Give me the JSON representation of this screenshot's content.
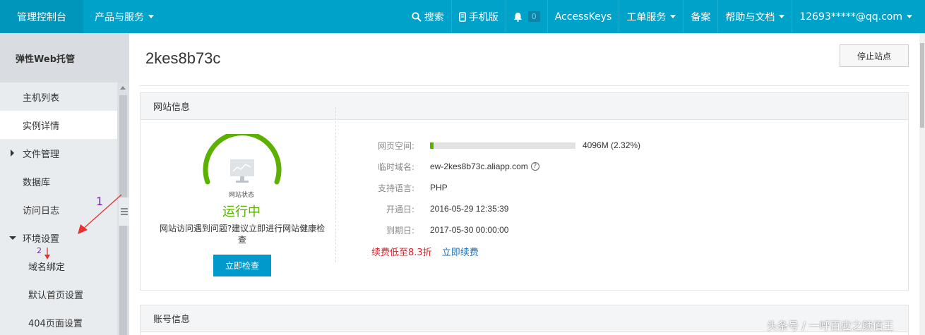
{
  "topbar": {
    "brand": "管理控制台",
    "products": "产品与服务",
    "search": "搜索",
    "mobile": "手机版",
    "notification_count": "0",
    "accesskeys": "AccessKeys",
    "tickets": "工单服务",
    "beian": "备案",
    "help": "帮助与文档",
    "user": "12693*****@qq.com"
  },
  "sidebar": {
    "title": "弹性Web托管",
    "items": [
      {
        "label": "主机列表"
      },
      {
        "label": "实例详情"
      },
      {
        "label": "文件管理"
      },
      {
        "label": "数据库"
      },
      {
        "label": "访问日志"
      },
      {
        "label": "环境设置"
      },
      {
        "label": "域名绑定"
      },
      {
        "label": "默认首页设置"
      },
      {
        "label": "404页面设置"
      }
    ]
  },
  "annotations": {
    "one": "1",
    "two": "2"
  },
  "main": {
    "title": "2kes8b73c",
    "stop_button": "停止站点",
    "site_panel": {
      "header": "网站信息",
      "status_label": "网站状态",
      "status": "运行中",
      "hint": "网站访问遇到问题?建议立即进行网站健康检查",
      "check_button": "立即检查",
      "space_label": "网页空间:",
      "space_value": "4096M (2.32%)",
      "space_fraction": 0.0232,
      "domain_label": "临时域名:",
      "domain_value": "ew-2kes8b73c.aliapp.com",
      "lang_label": "支持语言:",
      "lang_value": "PHP",
      "open_label": "开通日:",
      "open_value": "2016-05-29 12:35:39",
      "expire_label": "到期日:",
      "expire_value": "2017-05-30 00:00:00",
      "promo": "续费低至8.3折",
      "renew": "立即续费"
    },
    "account_panel": {
      "header": "账号信息"
    }
  },
  "watermark": "头条号 / 一呼百应之颜值王",
  "colors": {
    "topbar": "#00a2ca",
    "status_green": "#5bb000",
    "button_blue": "#0099cc",
    "promo_red": "#d9222a"
  }
}
